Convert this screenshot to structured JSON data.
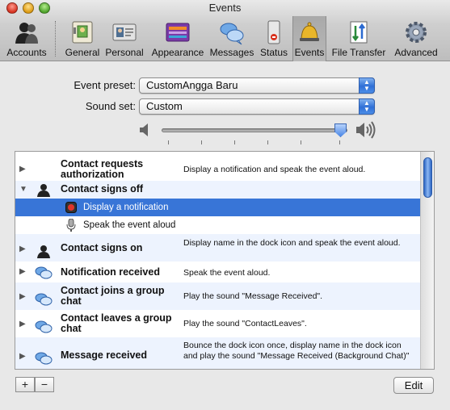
{
  "window": {
    "title": "Events"
  },
  "toolbar": {
    "items": [
      {
        "label": "Accounts",
        "icon": "accounts-icon"
      },
      {
        "label": "General",
        "icon": "general-icon"
      },
      {
        "label": "Personal",
        "icon": "personal-icon"
      },
      {
        "label": "Appearance",
        "icon": "appearance-icon"
      },
      {
        "label": "Messages",
        "icon": "messages-icon"
      },
      {
        "label": "Status",
        "icon": "status-icon"
      },
      {
        "label": "Events",
        "icon": "events-icon",
        "selected": true
      },
      {
        "label": "File Transfer",
        "icon": "file-transfer-icon"
      },
      {
        "label": "Advanced",
        "icon": "advanced-icon"
      }
    ]
  },
  "form": {
    "event_preset_label": "Event preset:",
    "event_preset_value": "CustomAngga Baru",
    "sound_set_label": "Sound set:",
    "sound_set_value": "Custom",
    "volume_level": 0.96
  },
  "events": [
    {
      "name": "Contact requests authorization",
      "desc": "Display a notification and speak the event aloud.",
      "icon": "none",
      "expanded": false
    },
    {
      "name": "Contact signs off",
      "desc": "",
      "icon": "person-icon",
      "expanded": true
    },
    {
      "sub": "Display a notification",
      "icon": "notification-icon",
      "selected": true
    },
    {
      "sub": "Speak the event aloud",
      "icon": "microphone-icon"
    },
    {
      "name": "Contact signs on",
      "desc": "Display name in the dock icon and speak the event aloud.",
      "icon": "person-icon"
    },
    {
      "name": "Notification received",
      "desc": "Speak the event aloud.",
      "icon": "chat-bubbles-icon"
    },
    {
      "name": "Contact joins a group chat",
      "desc": "Play the sound \"Message Received\".",
      "icon": "chat-bubbles-icon"
    },
    {
      "name": "Contact leaves a group chat",
      "desc": "Play the sound \"ContactLeaves\".",
      "icon": "chat-bubbles-icon"
    },
    {
      "name": "Message received",
      "desc": "Bounce the dock icon once, display name in the dock icon and play the sound \"Message Received (Background Chat)\"",
      "icon": "chat-bubbles-icon"
    }
  ],
  "buttons": {
    "add": "+",
    "remove": "−",
    "edit": "Edit"
  }
}
